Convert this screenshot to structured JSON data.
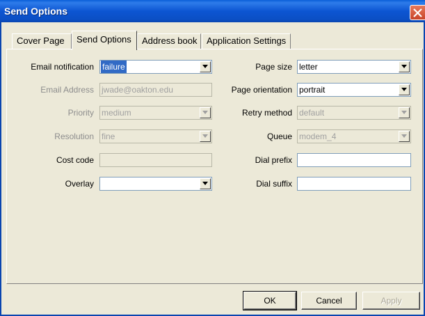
{
  "window": {
    "title": "Send Options",
    "close_icon": "close-x-icon"
  },
  "tabs": [
    {
      "label": "Cover Page",
      "active": false
    },
    {
      "label": "Send Options",
      "active": true
    },
    {
      "label": "Address book",
      "active": false
    },
    {
      "label": "Application Settings",
      "active": false
    }
  ],
  "form": {
    "email_notification": {
      "label": "Email notification",
      "value": "failure"
    },
    "email_address": {
      "label": "Email Address",
      "value": "jwade@oakton.edu"
    },
    "priority": {
      "label": "Priority",
      "value": "medium"
    },
    "resolution": {
      "label": "Resolution",
      "value": "fine"
    },
    "cost_code": {
      "label": "Cost code",
      "value": ""
    },
    "overlay": {
      "label": "Overlay",
      "value": ""
    },
    "page_size": {
      "label": "Page size",
      "value": "letter"
    },
    "page_orientation": {
      "label": "Page orientation",
      "value": "portrait"
    },
    "retry_method": {
      "label": "Retry method",
      "value": "default"
    },
    "queue": {
      "label": "Queue",
      "value": "modem_4"
    },
    "dial_prefix": {
      "label": "Dial prefix",
      "value": ""
    },
    "dial_suffix": {
      "label": "Dial suffix",
      "value": ""
    }
  },
  "buttons": {
    "ok": "OK",
    "cancel": "Cancel",
    "apply": "Apply"
  },
  "colors": {
    "titlebar": "#0B4FC4",
    "face": "#ECE9D8",
    "selection": "#316AC5",
    "close": "#D45837"
  }
}
